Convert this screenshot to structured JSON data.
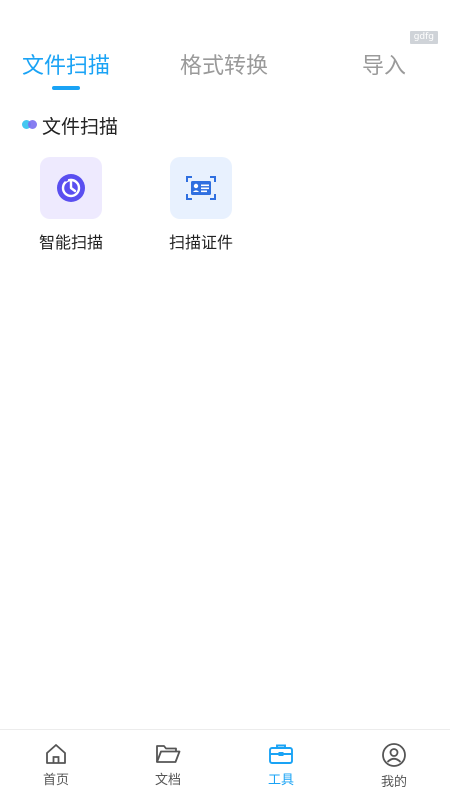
{
  "header": {
    "badge_text": "gdfg"
  },
  "tabs": [
    {
      "label": "文件扫描",
      "active": true
    },
    {
      "label": "格式转换",
      "active": false
    },
    {
      "label": "导入",
      "active": false
    }
  ],
  "section": {
    "title": "文件扫描"
  },
  "tools": [
    {
      "label": "智能扫描",
      "icon": "smart-scan-icon",
      "bg": "#eeeafe",
      "color": "#5a4ff0"
    },
    {
      "label": "扫描证件",
      "icon": "id-card-scan-icon",
      "bg": "#e8f1fe",
      "color": "#2f6fe0"
    }
  ],
  "nav": [
    {
      "label": "首页",
      "icon": "home-icon",
      "active": false
    },
    {
      "label": "文档",
      "icon": "folder-icon",
      "active": false
    },
    {
      "label": "工具",
      "icon": "toolbox-icon",
      "active": true
    },
    {
      "label": "我的",
      "icon": "user-icon",
      "active": false
    }
  ],
  "colors": {
    "accent": "#1aa3f5",
    "inactive": "#9a9a9a",
    "nav_icon": "#555555"
  }
}
